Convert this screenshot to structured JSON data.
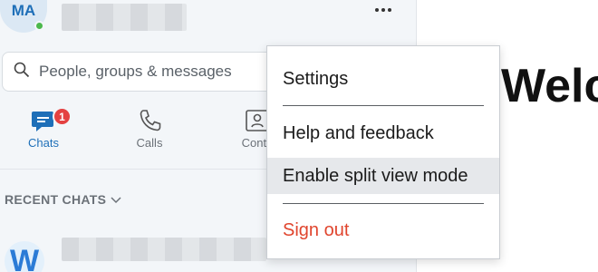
{
  "profile": {
    "initials": "MA"
  },
  "search": {
    "placeholder": "People, groups & messages"
  },
  "nav": {
    "tabs": [
      {
        "label": "Chats",
        "badge": "1",
        "active": true
      },
      {
        "label": "Calls"
      },
      {
        "label": "Conta"
      }
    ]
  },
  "recent_chats": {
    "label": "RECENT CHATS"
  },
  "chat_list": [
    {
      "avatar_letter": "W"
    }
  ],
  "main": {
    "heading": "Welc"
  },
  "menu": {
    "settings": "Settings",
    "help": "Help and feedback",
    "split_view": "Enable split view mode",
    "sign_out": "Sign out"
  },
  "colors": {
    "accent": "#1e6fb8",
    "badge": "#e44141",
    "sign_out": "#e0452e",
    "presence": "#4cb84c"
  }
}
